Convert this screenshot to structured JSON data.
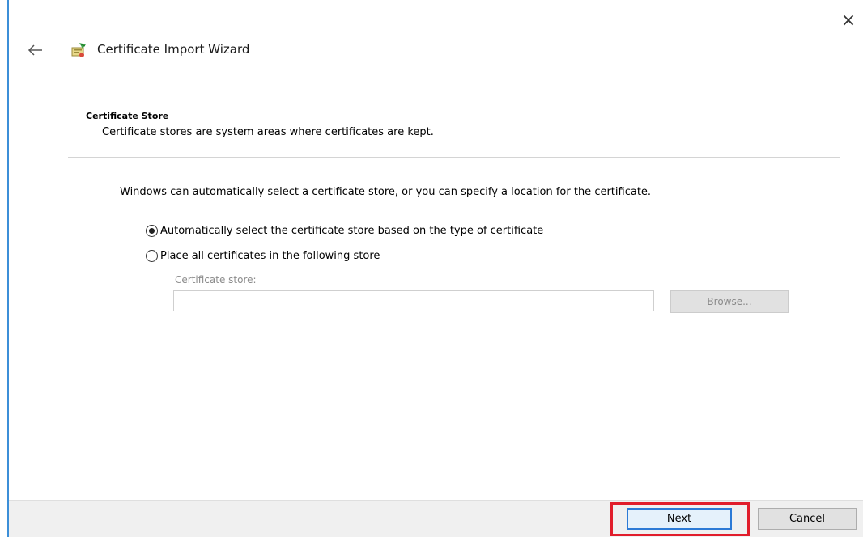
{
  "window": {
    "title": "Certificate Import Wizard",
    "close_glyph": "×"
  },
  "page": {
    "heading": "Certificate Store",
    "description": "Certificate stores are system areas where certificates are kept.",
    "intro": "Windows can automatically select a certificate store, or you can specify a location for the certificate."
  },
  "options": [
    {
      "label": "Automatically select the certificate store based on the type of certificate",
      "selected": true
    },
    {
      "label": "Place all certificates in the following store",
      "selected": false
    }
  ],
  "store": {
    "label": "Certificate store:",
    "value": "",
    "browse_label": "Browse..."
  },
  "footer": {
    "next_label": "Next",
    "cancel_label": "Cancel"
  },
  "icons": {
    "close": "close-icon",
    "back": "back-arrow-icon",
    "wizard": "certificate-wizard-icon"
  },
  "colors": {
    "window_edge": "#3c8fd8",
    "highlight": "#e11d2b",
    "default_button_border": "#2c7ad6"
  }
}
